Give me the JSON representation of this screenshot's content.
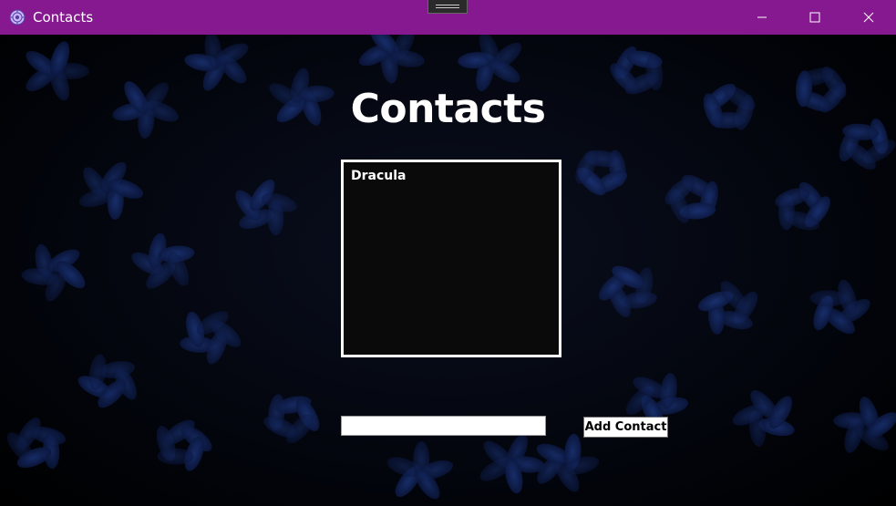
{
  "window": {
    "title": "Contacts",
    "titlebar_color": "#86198f",
    "icon": "flower-icon",
    "controls": {
      "minimize": "minimize-icon",
      "maximize": "maximize-icon",
      "close": "close-icon"
    }
  },
  "main": {
    "heading": "Contacts",
    "contacts": [
      "Dracula"
    ],
    "input": {
      "value": "",
      "placeholder": ""
    },
    "add_button_label": "Add Contact"
  },
  "colors": {
    "background": "#000000",
    "leaf_blue": "#1e3fa8",
    "list_background": "#0a0a0a"
  }
}
